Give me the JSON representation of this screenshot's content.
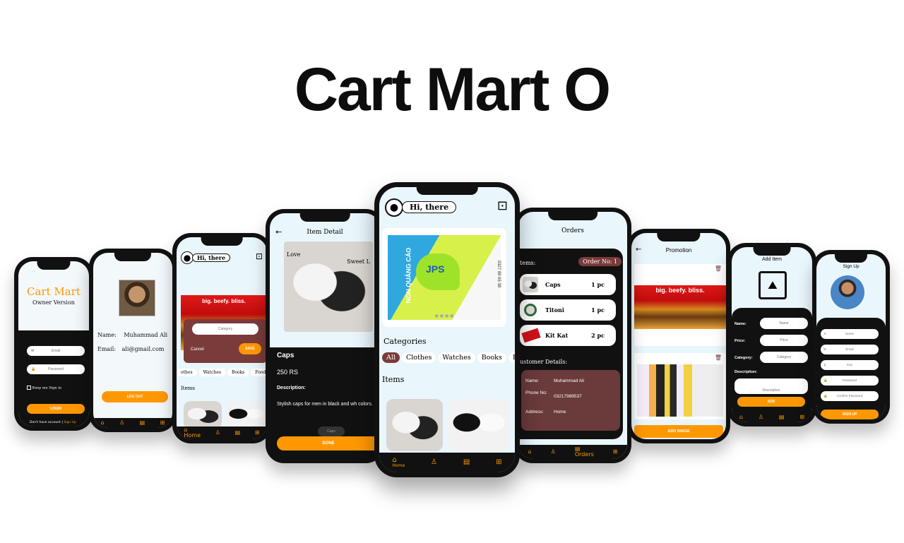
{
  "header": {
    "title": "Cart Mart O"
  },
  "colors": {
    "accent": "#ff9800",
    "dark": "#111111",
    "screen_bg": "#e9f6fc",
    "maroon": "#7a3b3b"
  },
  "phone1": {
    "app_name": "Cart Mart",
    "subtitle": "Owner Version",
    "email_placeholder": "Email",
    "password_placeholder": "Password",
    "keep_signed_in": "Keep me Sign in",
    "login_button": "LOGIN",
    "no_account": "Don't have account |",
    "signup_link": "Sign Up"
  },
  "phone2": {
    "name_label": "Name:",
    "name_value": "Muhammad Ali",
    "email_label": "Email:",
    "email_value": "ali@gmail.com",
    "logout_button": "LOG OUT"
  },
  "phone3": {
    "greeting": "Hi, there",
    "banner_text": "big. beefy. bliss.",
    "category_placeholder": "Category",
    "cancel": "Cancel",
    "save": "SAVE",
    "chips": [
      "othes",
      "Watches",
      "Books",
      "Food"
    ],
    "items_label": "Items",
    "nav_home": "Home"
  },
  "phone4": {
    "title": "Item Detail",
    "img_text_love": "Love",
    "img_text_sweet": "Sweet L",
    "item_name": "Caps",
    "price": "250 RS",
    "description_label": "Description:",
    "description": "Stylish caps for men in black and wh colors.",
    "toast": "Caps",
    "done": "DONE"
  },
  "phone5": {
    "greeting": "Hi, there",
    "promo_brand": "JPS",
    "promo_vertical": "NÓN QUẢNG CÁO",
    "promo_phone": "0327 89 65 38",
    "categories_label": "Categories",
    "chips": [
      "All",
      "Clothes",
      "Watches",
      "Books",
      "Foo"
    ],
    "items_label": "Items",
    "nav_home": "Home"
  },
  "phone6": {
    "title": "Orders",
    "items_label": "tems:",
    "order_no": "Order No: 1",
    "orders": [
      {
        "name": "Caps",
        "qty": "1 pc"
      },
      {
        "name": "Titoni",
        "qty": "1 pc"
      },
      {
        "name": "Kit Kat",
        "qty": "2 pc"
      }
    ],
    "customer_label": "ustomer Details:",
    "name_label": "Name:",
    "name_value": "Muhammad Ali",
    "phone_label": "Phone No:",
    "phone_value": "03217989537",
    "address_label": "Address:",
    "address_value": "Home",
    "nav_orders": "Orders"
  },
  "phone7": {
    "title": "Promotion",
    "banner_text": "big. beefy. bliss.",
    "add_image": "ADD IMAGE"
  },
  "phone8": {
    "title": "Add Item",
    "name_label": "Name:",
    "name_placeholder": "Name",
    "price_label": "Price:",
    "price_placeholder": "Price",
    "category_label": "Category:",
    "category_placeholder": "Category",
    "description_label": "Description:",
    "description_placeholder": "Description",
    "add": "ADD"
  },
  "phone9": {
    "title": "Sign Up",
    "name_placeholder": "Name",
    "email_placeholder": "Email",
    "key_placeholder": "Key",
    "password_placeholder": "Password",
    "confirm_placeholder": "Confirm Password",
    "signup": "SIGN UP"
  }
}
